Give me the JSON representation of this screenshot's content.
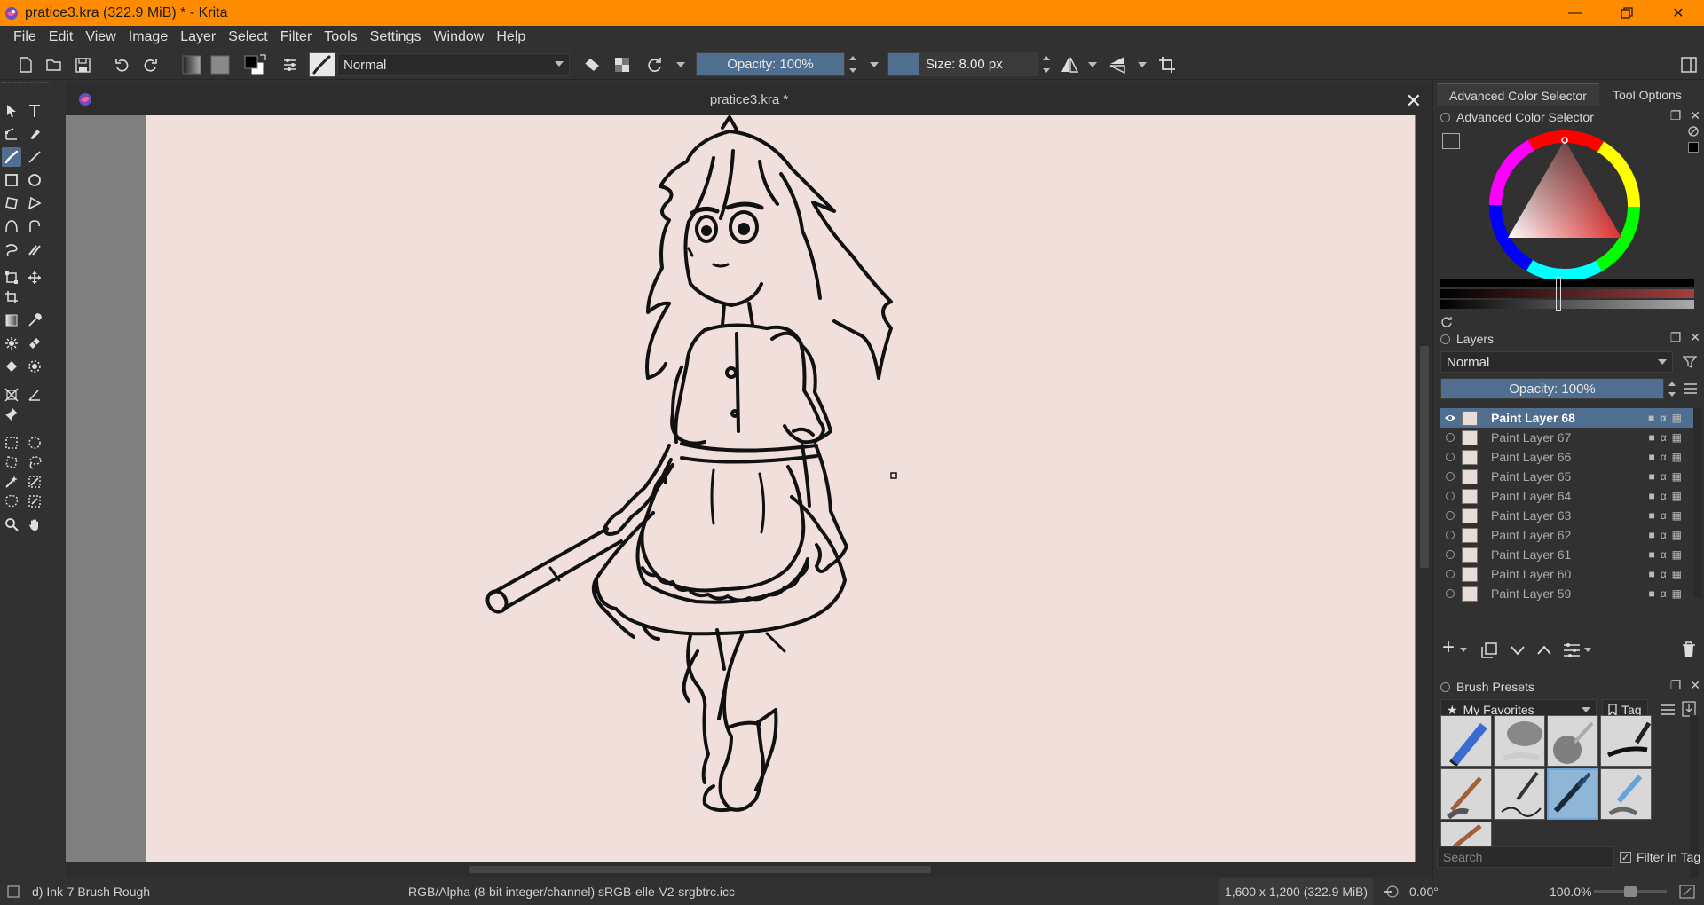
{
  "window": {
    "title": "pratice3.kra (322.9 MiB)  * - Krita"
  },
  "menu": [
    "File",
    "Edit",
    "View",
    "Image",
    "Layer",
    "Select",
    "Filter",
    "Tools",
    "Settings",
    "Window",
    "Help"
  ],
  "toolbar": {
    "blend_mode": "Normal",
    "opacity_label": "Opacity: 100%",
    "opacity_value": 100,
    "size_label": "Size: 8.00 px"
  },
  "document": {
    "tab_title": "pratice3.kra *"
  },
  "dock": {
    "tabs": [
      "Advanced Color Selector",
      "Tool Options"
    ],
    "color_selector_title": "Advanced Color Selector",
    "layers": {
      "title": "Layers",
      "blend_mode": "Normal",
      "opacity_label": "Opacity:  100%",
      "items": [
        {
          "name": "Paint Layer 68",
          "selected": true,
          "visible": true
        },
        {
          "name": "Paint Layer 67",
          "selected": false,
          "visible": false
        },
        {
          "name": "Paint Layer 66",
          "selected": false,
          "visible": false
        },
        {
          "name": "Paint Layer 65",
          "selected": false,
          "visible": false
        },
        {
          "name": "Paint Layer 64",
          "selected": false,
          "visible": false
        },
        {
          "name": "Paint Layer 63",
          "selected": false,
          "visible": false
        },
        {
          "name": "Paint Layer 62",
          "selected": false,
          "visible": false
        },
        {
          "name": "Paint Layer 61",
          "selected": false,
          "visible": false
        },
        {
          "name": "Paint Layer 60",
          "selected": false,
          "visible": false
        },
        {
          "name": "Paint Layer 59",
          "selected": false,
          "visible": false
        }
      ]
    },
    "brush_presets": {
      "title": "Brush Presets",
      "tag": "My Favorites",
      "tag_button": "Tag",
      "search_placeholder": "Search",
      "filter_label": "Filter in Tag"
    }
  },
  "status": {
    "brush": "d) Ink-7 Brush Rough",
    "color_space": "RGB/Alpha (8-bit integer/channel)  sRGB-elle-V2-srgbtrc.icc",
    "image_size": "1,600 x 1,200 (322.9 MiB)",
    "rotation": "0.00°",
    "zoom": "100.0%"
  },
  "colors": {
    "accent": "#4f6e90",
    "titlebar": "#ff8c00",
    "canvas": "#f0dfdb"
  }
}
